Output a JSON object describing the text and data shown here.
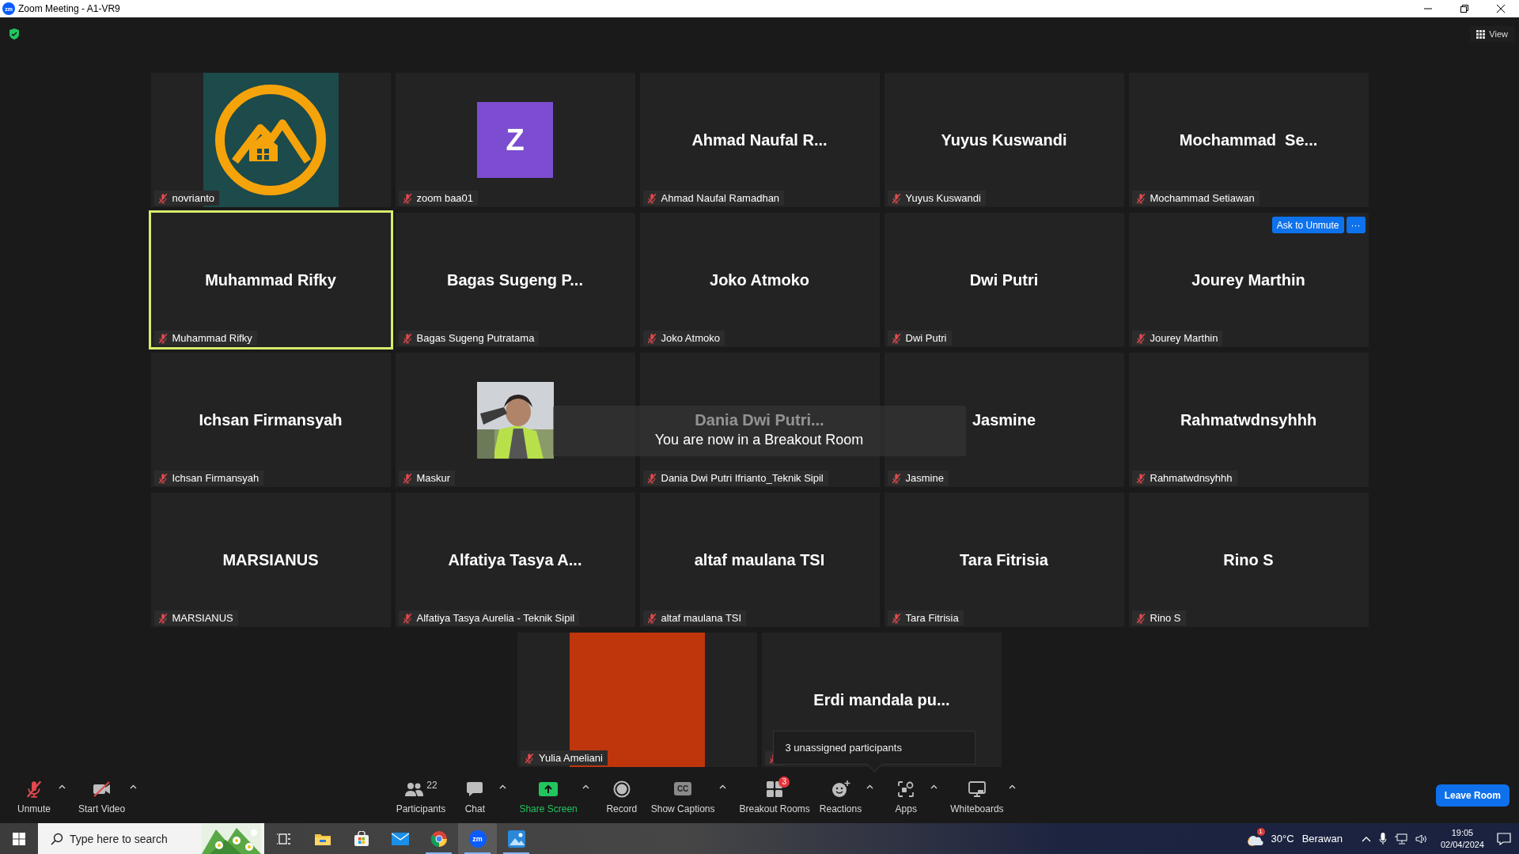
{
  "window": {
    "title": "Zoom Meeting - A1-VR9",
    "app_icon": "zm"
  },
  "top_bar": {
    "view_button": "View"
  },
  "tiles": [
    {
      "kind": "logo",
      "name_label": "novrianto",
      "muted": true,
      "speaking": false
    },
    {
      "kind": "letter",
      "letter": "Z",
      "color": "#7c4dd0",
      "name_label": "zoom baa01",
      "muted": true,
      "speaking": false
    },
    {
      "kind": "name",
      "display_name": "Ahmad Naufal R...",
      "name_label": "Ahmad Naufal Ramadhan",
      "muted": true,
      "speaking": false
    },
    {
      "kind": "name",
      "display_name": "Yuyus Kuswandi",
      "name_label": "Yuyus Kuswandi",
      "muted": true,
      "speaking": false
    },
    {
      "kind": "name",
      "display_name": "Mochammad  Se...",
      "name_label": "Mochammad Setiawan",
      "muted": true,
      "speaking": false
    },
    {
      "kind": "name",
      "display_name": "Muhammad Rifky",
      "name_label": "Muhammad Rifky",
      "muted": true,
      "speaking": true
    },
    {
      "kind": "name",
      "display_name": "Bagas Sugeng P...",
      "name_label": "Bagas Sugeng Putratama",
      "muted": true,
      "speaking": false
    },
    {
      "kind": "name",
      "display_name": "Joko Atmoko",
      "name_label": "Joko Atmoko",
      "muted": true,
      "speaking": false
    },
    {
      "kind": "name",
      "display_name": "Dwi Putri",
      "name_label": "Dwi Putri",
      "muted": true,
      "speaking": false
    },
    {
      "kind": "name",
      "display_name": "Jourey Marthin",
      "name_label": "Jourey Marthin",
      "muted": true,
      "speaking": false,
      "actions": [
        "Ask to Unmute",
        "···"
      ]
    },
    {
      "kind": "name",
      "display_name": "Ichsan Firmansyah",
      "name_label": "Ichsan Firmansyah",
      "muted": true,
      "speaking": false
    },
    {
      "kind": "picture",
      "name_label": "Maskur",
      "muted": true,
      "speaking": false
    },
    {
      "kind": "name",
      "display_name": "Dania Dwi Putri...",
      "name_label": "Dania Dwi Putri Ifrianto_Teknik Sipil",
      "muted": true,
      "speaking": false
    },
    {
      "kind": "name",
      "display_name": "Jasmine",
      "name_label": "Jasmine",
      "muted": true,
      "speaking": false
    },
    {
      "kind": "name",
      "display_name": "Rahmatwdnsyhhh",
      "name_label": "Rahmatwdnsyhhh",
      "muted": true,
      "speaking": false
    },
    {
      "kind": "name",
      "display_name": "MARSIANUS",
      "name_label": "MARSIANUS",
      "muted": true,
      "speaking": false
    },
    {
      "kind": "name",
      "display_name": "Alfatiya Tasya A...",
      "name_label": "Alfatiya Tasya Aurelia - Teknik Sipil",
      "muted": true,
      "speaking": false
    },
    {
      "kind": "name",
      "display_name": "altaf maulana TSI",
      "name_label": "altaf maulana TSI",
      "muted": true,
      "speaking": false
    },
    {
      "kind": "name",
      "display_name": "Tara Fitrisia",
      "name_label": "Tara Fitrisia",
      "muted": true,
      "speaking": false
    },
    {
      "kind": "name",
      "display_name": "Rino S",
      "name_label": "Rino S",
      "muted": true,
      "speaking": false
    },
    {
      "kind": "color",
      "color": "#bf360c",
      "name_label": "Yulia Ameliani",
      "muted": true,
      "speaking": false
    },
    {
      "kind": "name",
      "display_name": "Erdi mandala pu...",
      "muted": true,
      "speaking": false
    }
  ],
  "toast": {
    "text": "You are now in a Breakout Room"
  },
  "breakout_popup": {
    "text": "3 unassigned participants"
  },
  "toolbar": {
    "left_items": [
      {
        "kind": "mic",
        "label": "Unmute",
        "caret": true
      },
      {
        "kind": "video",
        "label": "Start Video",
        "caret": true
      }
    ],
    "center_items": [
      {
        "kind": "participants",
        "label": "Participants",
        "count": "22",
        "caret": false
      },
      {
        "kind": "chat",
        "label": "Chat",
        "caret": true
      },
      {
        "kind": "share",
        "label": "Share Screen",
        "caret": true
      },
      {
        "kind": "record",
        "label": "Record",
        "caret": false
      },
      {
        "kind": "captions",
        "label": "Show Captions",
        "icon_text": "CC",
        "caret": true
      },
      {
        "kind": "breakout",
        "label": "Breakout Rooms",
        "badge": "3",
        "caret": false
      },
      {
        "kind": "reactions",
        "label": "Reactions",
        "caret": true
      },
      {
        "kind": "apps",
        "label": "Apps",
        "caret": true
      },
      {
        "kind": "whiteboard",
        "label": "Whiteboards",
        "caret": true
      }
    ],
    "leave_button": "Leave Room"
  },
  "taskbar": {
    "search_placeholder": "Type here to search",
    "apps": [
      {
        "kind": "task-view",
        "running": false,
        "selected": false
      },
      {
        "kind": "folder",
        "running": false,
        "selected": false
      },
      {
        "kind": "store",
        "running": false,
        "selected": false
      },
      {
        "kind": "mail",
        "running": false,
        "selected": false
      },
      {
        "kind": "chrome",
        "running": true,
        "selected": false
      },
      {
        "kind": "zoom",
        "text": "zm",
        "running": true,
        "selected": true
      },
      {
        "kind": "photos",
        "running": true,
        "selected": false
      }
    ],
    "weather": {
      "badge": "1",
      "temperature": "30°C",
      "condition": "Berawan"
    },
    "time": "19:05",
    "date": "02/04/2024"
  }
}
